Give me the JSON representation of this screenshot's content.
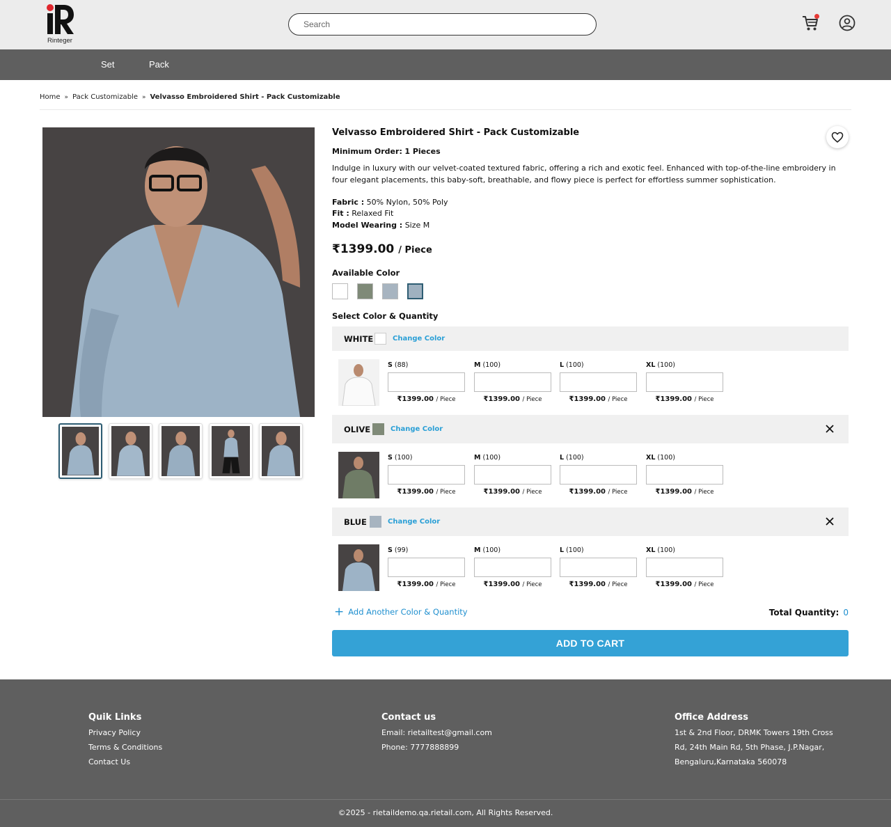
{
  "header": {
    "logo_text": "Rinteger",
    "search_placeholder": "Search"
  },
  "nav": {
    "items": [
      {
        "label": "Set"
      },
      {
        "label": "Pack"
      }
    ]
  },
  "breadcrumb": {
    "items": [
      "Home",
      "Pack Customizable",
      "Velvasso Embroidered Shirt - Pack Customizable"
    ],
    "separator": "»"
  },
  "product": {
    "title": "Velvasso Embroidered Shirt - Pack Customizable",
    "min_order_label": "Minimum Order:",
    "min_order_value": "1 Pieces",
    "description": "Indulge in luxury with our velvet-coated textured fabric, offering a rich and exotic feel. Enhanced with top-of-the-line embroidery in four elegant placements, this baby-soft, breathable, and flowy piece is perfect for effortless summer sophistication.",
    "specs": [
      {
        "label": "Fabric :",
        "value": "50% Nylon, 50% Poly"
      },
      {
        "label": "Fit :",
        "value": "Relaxed Fit"
      },
      {
        "label": "Model Wearing :",
        "value": "Size M"
      }
    ],
    "price": "₹1399.00",
    "price_unit": "/ Piece",
    "available_color_label": "Available Color",
    "swatch_colors": [
      "#ffffff",
      "#7f8a78",
      "#a7b4c0",
      "#9fb1c0"
    ],
    "select_label": "Select Color & Quantity"
  },
  "color_blocks": [
    {
      "name": "WHITE",
      "swatch": "#ffffff",
      "change_label": "Change Color",
      "sizes": [
        {
          "size": "S",
          "stock": "(88)",
          "price": "₹1399.00",
          "unit": "/ Piece"
        },
        {
          "size": "M",
          "stock": "(100)",
          "price": "₹1399.00",
          "unit": "/ Piece"
        },
        {
          "size": "L",
          "stock": "(100)",
          "price": "₹1399.00",
          "unit": "/ Piece"
        },
        {
          "size": "XL",
          "stock": "(100)",
          "price": "₹1399.00",
          "unit": "/ Piece"
        }
      ]
    },
    {
      "name": "OLIVE",
      "swatch": "#7f8a78",
      "change_label": "Change Color",
      "sizes": [
        {
          "size": "S",
          "stock": "(100)",
          "price": "₹1399.00",
          "unit": "/ Piece"
        },
        {
          "size": "M",
          "stock": "(100)",
          "price": "₹1399.00",
          "unit": "/ Piece"
        },
        {
          "size": "L",
          "stock": "(100)",
          "price": "₹1399.00",
          "unit": "/ Piece"
        },
        {
          "size": "XL",
          "stock": "(100)",
          "price": "₹1399.00",
          "unit": "/ Piece"
        }
      ]
    },
    {
      "name": "BLUE",
      "swatch": "#a7b4c0",
      "change_label": "Change Color",
      "sizes": [
        {
          "size": "S",
          "stock": "(99)",
          "price": "₹1399.00",
          "unit": "/ Piece"
        },
        {
          "size": "M",
          "stock": "(100)",
          "price": "₹1399.00",
          "unit": "/ Piece"
        },
        {
          "size": "L",
          "stock": "(100)",
          "price": "₹1399.00",
          "unit": "/ Piece"
        },
        {
          "size": "XL",
          "stock": "(100)",
          "price": "₹1399.00",
          "unit": "/ Piece"
        }
      ]
    }
  ],
  "actions": {
    "add_another_label": "Add Another Color & Quantity",
    "total_quantity_label": "Total Quantity:",
    "total_quantity_value": "0",
    "add_to_cart_label": "ADD TO CART"
  },
  "footer": {
    "quick_links": {
      "title": "Quik Links",
      "items": [
        "Privacy Policy",
        "Terms & Conditions",
        "Contact Us"
      ]
    },
    "contact": {
      "title": "Contact us",
      "email": "Email: rietailtest@gmail.com",
      "phone": "Phone: 7777888899"
    },
    "address": {
      "title": "Office Address",
      "lines": [
        "1st & 2nd Floor, DRMK Towers 19th Cross",
        "Rd, 24th Main Rd, 5th Phase, J.P.Nagar,",
        "Bengaluru,Karnataka 560078"
      ]
    },
    "copyright": "©2025 - rietaildemo.qa.rietail.com, All Rights Reserved."
  },
  "colors": {
    "accent": "#34a2d6",
    "link": "#1f8fcf",
    "nav_bg": "#5f5f5f",
    "header_bg": "#ececec"
  }
}
